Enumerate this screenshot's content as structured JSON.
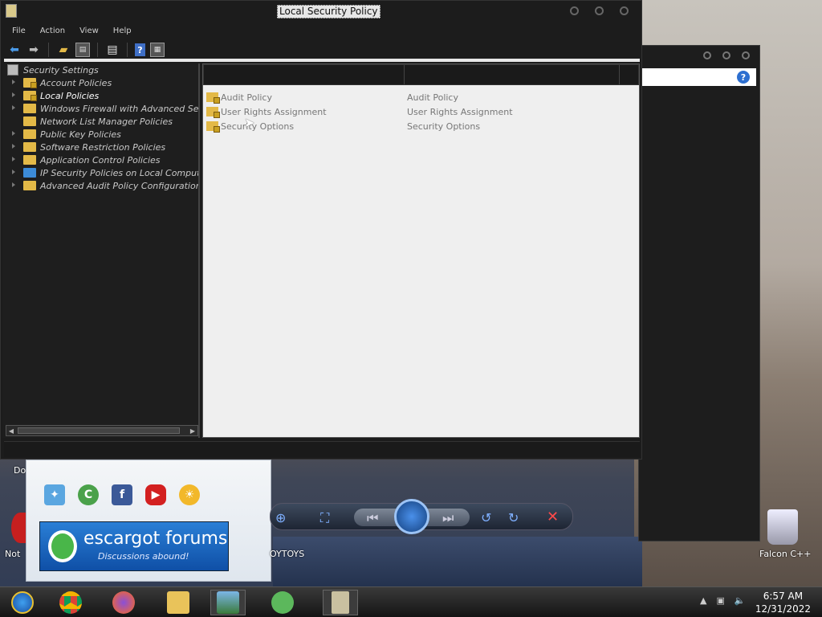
{
  "window": {
    "title": "Local Security Policy",
    "menu": [
      "File",
      "Action",
      "View",
      "Help"
    ]
  },
  "tree": {
    "root": "Security Settings",
    "items": [
      {
        "label": "Account Policies",
        "icon": "folder-lock"
      },
      {
        "label": "Local Policies",
        "icon": "folder-lock",
        "selected": true
      },
      {
        "label": "Windows Firewall with Advanced Securi",
        "icon": "folder"
      },
      {
        "label": "Network List Manager Policies",
        "icon": "folder"
      },
      {
        "label": "Public Key Policies",
        "icon": "folder"
      },
      {
        "label": "Software Restriction Policies",
        "icon": "folder"
      },
      {
        "label": "Application Control Policies",
        "icon": "folder"
      },
      {
        "label": "IP Security Policies on Local Computer",
        "icon": "network"
      },
      {
        "label": "Advanced Audit Policy Configuration",
        "icon": "folder"
      }
    ]
  },
  "list": {
    "rows": [
      {
        "name": "Audit Policy",
        "description": "Audit Policy"
      },
      {
        "name": "User Rights Assignment",
        "description": "User Rights Assignment"
      },
      {
        "name": "Security Options",
        "description": "Security Options"
      }
    ]
  },
  "desktop": {
    "gadget_banner_title": "escargot forums",
    "gadget_banner_sub": "Discussions abound!",
    "label_left_top": "Do",
    "label_left_bottom": "Not",
    "label_center": "OYTOYS",
    "recycle_label": "Falcon C++"
  },
  "taskbar": {
    "time": "6:57 AM",
    "date": "12/31/2022"
  }
}
